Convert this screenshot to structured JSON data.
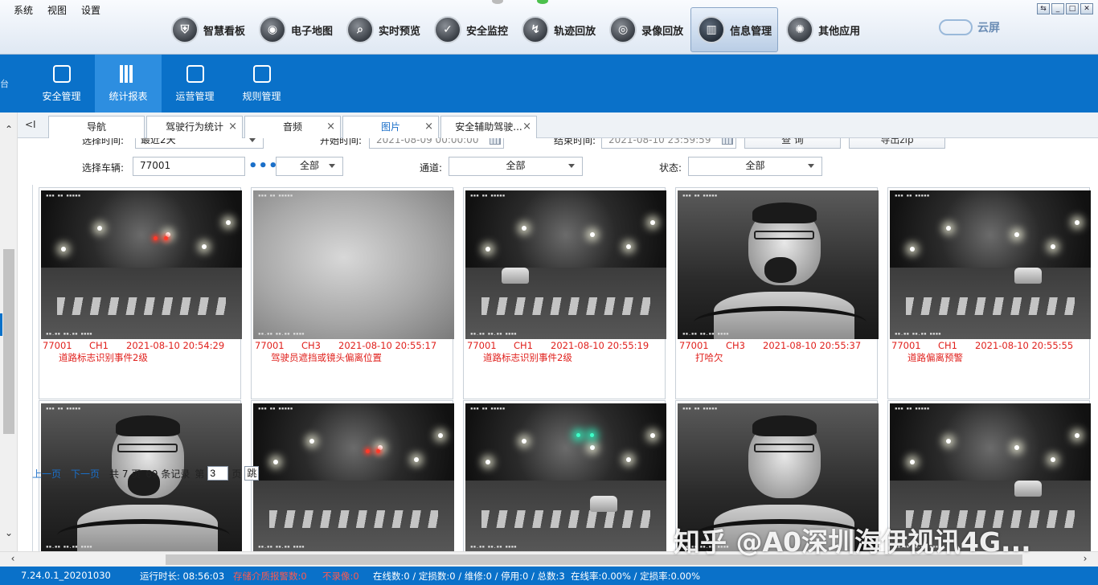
{
  "menubar": [
    "系统",
    "视图",
    "设置"
  ],
  "main_nav": [
    {
      "label": "智慧看板",
      "icon": "shield-icon"
    },
    {
      "label": "电子地图",
      "icon": "map-pin-icon"
    },
    {
      "label": "实时预览",
      "icon": "search-icon"
    },
    {
      "label": "安全监控",
      "icon": "shield-check-icon"
    },
    {
      "label": "轨迹回放",
      "icon": "route-icon"
    },
    {
      "label": "录像回放",
      "icon": "video-reel-icon"
    },
    {
      "label": "信息管理",
      "icon": "bar-chart-icon",
      "active": true
    },
    {
      "label": "其他应用",
      "icon": "apps-icon"
    }
  ],
  "cloud_screen": "云屏",
  "sub_nav": [
    {
      "label": "安全管理",
      "icon": "play-shield-icon"
    },
    {
      "label": "统计报表",
      "icon": "bar-chart-icon",
      "active": true
    },
    {
      "label": "运营管理",
      "icon": "dashboard-icon"
    },
    {
      "label": "规则管理",
      "icon": "window-icon"
    }
  ],
  "sub_nav_edge": "台",
  "tabs": [
    {
      "label": "导航",
      "closable": false
    },
    {
      "label": "驾驶行为统计",
      "closable": true
    },
    {
      "label": "音频",
      "closable": true
    },
    {
      "label": "图片",
      "closable": true,
      "active": true
    },
    {
      "label": "安全辅助驾驶...",
      "closable": true
    }
  ],
  "filters": {
    "time_label": "选择时间:",
    "time_value": "最近2天",
    "start_label": "开始时间:",
    "start_value": "2021-08-09 00:00:00",
    "end_label": "结束时间:",
    "end_value": "2021-08-10 23:59:59",
    "query_button": "查 询",
    "export_button": "导出zip",
    "vehicle_label": "选择车辆:",
    "vehicle_value": "77001",
    "vehicle_more": "•••",
    "scope_value": "全部",
    "channel_label": "通道:",
    "channel_value": "全部",
    "status_label": "状态:",
    "status_value": "全部"
  },
  "photos": [
    {
      "vehicle": "77001",
      "channel": "CH1",
      "time": "2021-08-10 20:54:29",
      "event": "道路标志识别事件2级",
      "kind": "road"
    },
    {
      "vehicle": "77001",
      "channel": "CH3",
      "time": "2021-08-10 20:55:17",
      "event": "驾驶员遮挡或镜头偏离位置",
      "kind": "fog"
    },
    {
      "vehicle": "77001",
      "channel": "CH1",
      "time": "2021-08-10 20:55:19",
      "event": "道路标志识别事件2级",
      "kind": "road"
    },
    {
      "vehicle": "77001",
      "channel": "CH3",
      "time": "2021-08-10 20:55:37",
      "event": "打哈欠",
      "kind": "cab"
    },
    {
      "vehicle": "77001",
      "channel": "CH1",
      "time": "2021-08-10 20:55:55",
      "event": "道路偏离预警",
      "kind": "road"
    },
    {
      "vehicle": "",
      "channel": "",
      "time": "",
      "event": "",
      "kind": "cab"
    },
    {
      "vehicle": "",
      "channel": "",
      "time": "",
      "event": "",
      "kind": "road"
    },
    {
      "vehicle": "",
      "channel": "",
      "time": "",
      "event": "",
      "kind": "road"
    },
    {
      "vehicle": "",
      "channel": "",
      "time": "",
      "event": "",
      "kind": "cab"
    },
    {
      "vehicle": "",
      "channel": "",
      "time": "",
      "event": "",
      "kind": "road"
    }
  ],
  "pager": {
    "prev": "上一页",
    "next": "下一页",
    "total_pages": "共 7 页",
    "records": "69 条记录",
    "page_prefix": "第",
    "page_value": "3",
    "page_suffix": "页",
    "jump": "跳"
  },
  "watermark": "知乎 @A0深圳海伊视讯4G...",
  "status_bar": {
    "version": "7.24.0.1_20201030",
    "uptime": "运行时长: 08:56:03",
    "storage_alarm": "存储介质报警数:0",
    "no_record": "不录像:0",
    "counts": "在线数:0 / 定损数:0 / 维修:0 / 停用:0 / 总数:3",
    "rates": "在线率:0.00% / 定损率:0.00%"
  },
  "colors": {
    "accent": "#0a71c9",
    "alert_text": "#e0201c",
    "link": "#1a6fc9"
  }
}
